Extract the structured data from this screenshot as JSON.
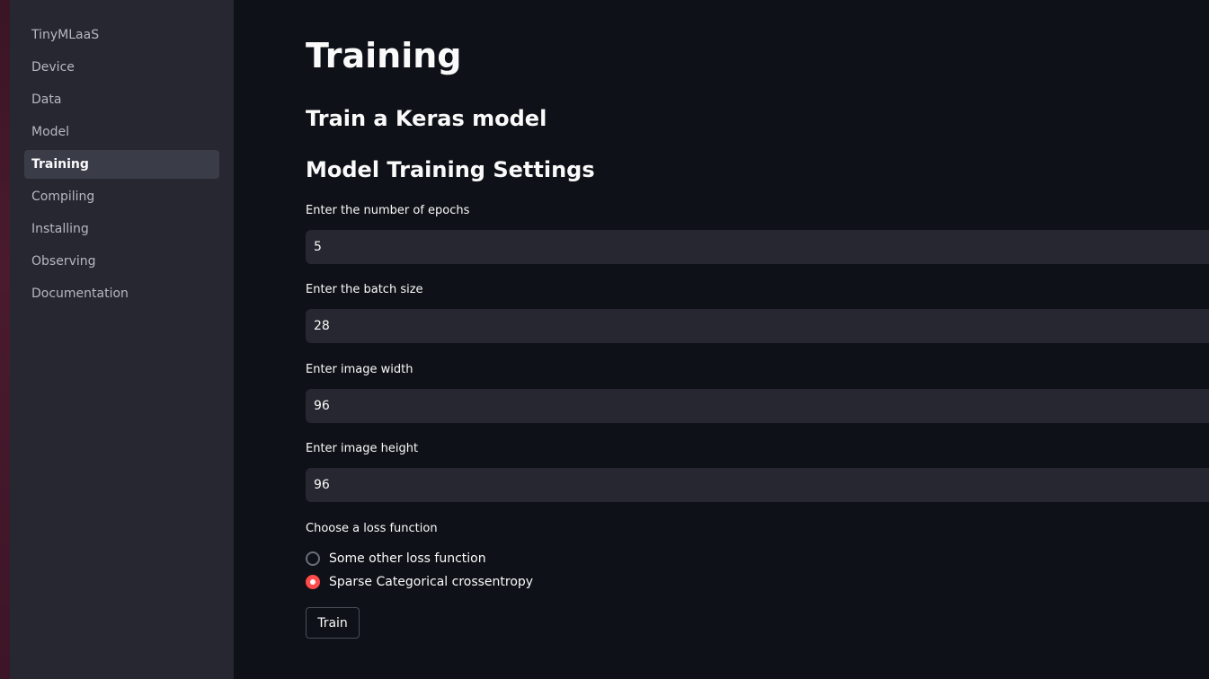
{
  "sidebar": {
    "items": [
      {
        "label": "TinyMLaaS"
      },
      {
        "label": "Device"
      },
      {
        "label": "Data"
      },
      {
        "label": "Model"
      },
      {
        "label": "Training"
      },
      {
        "label": "Compiling"
      },
      {
        "label": "Installing"
      },
      {
        "label": "Observing"
      },
      {
        "label": "Documentation"
      }
    ],
    "active": "Training"
  },
  "main": {
    "title": "Training",
    "subheader": "Train a Keras model",
    "section_title": "Model Training Settings",
    "fields": [
      {
        "label": "Enter the number of epochs",
        "value": "5"
      },
      {
        "label": "Enter the batch size",
        "value": "28"
      },
      {
        "label": "Enter image width",
        "value": "96"
      },
      {
        "label": "Enter image height",
        "value": "96"
      }
    ],
    "loss": {
      "label": "Choose a loss function",
      "options": [
        {
          "label": "Some other loss function"
        },
        {
          "label": "Sparse Categorical crossentropy"
        }
      ],
      "selected": "Sparse Categorical crossentropy"
    },
    "train_button": "Train"
  },
  "colors": {
    "background": "#0e1117",
    "sidebar": "#262730",
    "accent": "#ff4b4b"
  }
}
